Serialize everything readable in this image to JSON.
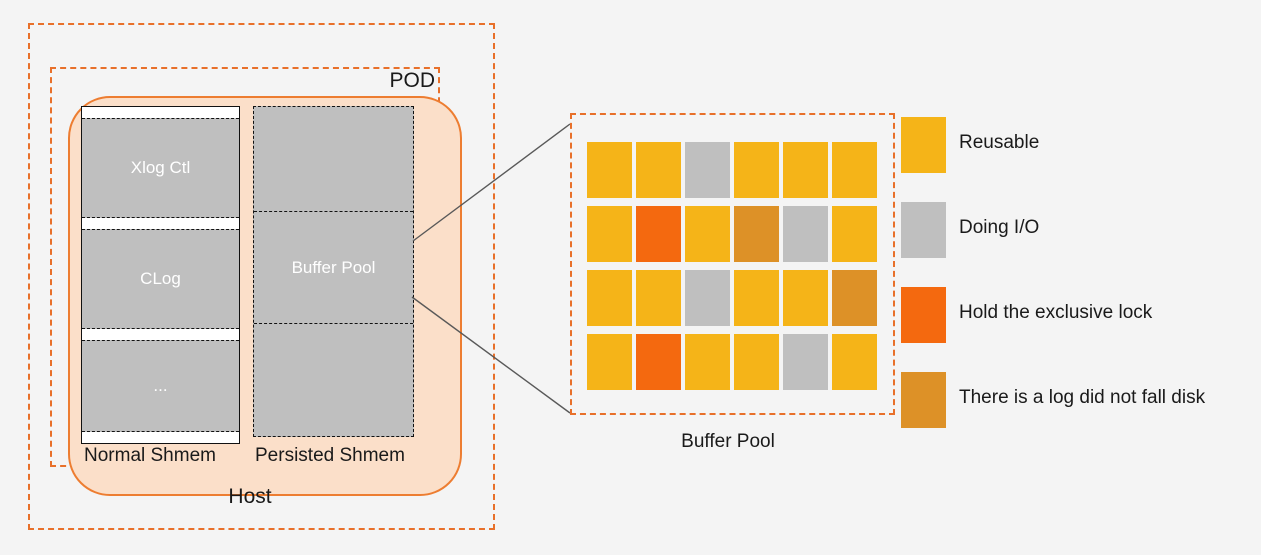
{
  "colors": {
    "reusable": "#f5b418",
    "doing_io": "#bfbfbf",
    "exclusive_lock": "#f4690f",
    "log_not_flushed": "#dd9127",
    "dashed_orange": "#e8702a",
    "host_fill": "#fbdfc9",
    "host_stroke": "#ed7d31",
    "background": "#f4f4f4",
    "shmem_gray": "#bfbfbf"
  },
  "host": {
    "outer_label": "Host",
    "pod_label": "POD"
  },
  "normal_shmem": {
    "caption": "Normal Shmem",
    "segments": [
      {
        "label": "Xlog Ctl"
      },
      {
        "label": "CLog"
      },
      {
        "label": "..."
      }
    ]
  },
  "persisted_shmem": {
    "caption": "Persisted Shmem",
    "segments": [
      {
        "label": ""
      },
      {
        "label": "Buffer Pool"
      },
      {
        "label": ""
      }
    ]
  },
  "buffer_pool_detail": {
    "caption": "Buffer Pool",
    "columns": 6,
    "rows": 4,
    "cells": [
      "reusable",
      "reusable",
      "doing_io",
      "reusable",
      "reusable",
      "reusable",
      "reusable",
      "exclusive_lock",
      "reusable",
      "log_not_flushed",
      "doing_io",
      "reusable",
      "reusable",
      "reusable",
      "doing_io",
      "reusable",
      "reusable",
      "log_not_flushed",
      "reusable",
      "exclusive_lock",
      "reusable",
      "reusable",
      "doing_io",
      "reusable"
    ]
  },
  "legend": {
    "items": [
      {
        "key": "reusable",
        "label": "Reusable"
      },
      {
        "key": "doing_io",
        "label": "Doing I/O"
      },
      {
        "key": "exclusive_lock",
        "label": "Hold the exclusive lock"
      },
      {
        "key": "log_not_flushed",
        "label": "There is a log did not fall disk"
      }
    ]
  }
}
